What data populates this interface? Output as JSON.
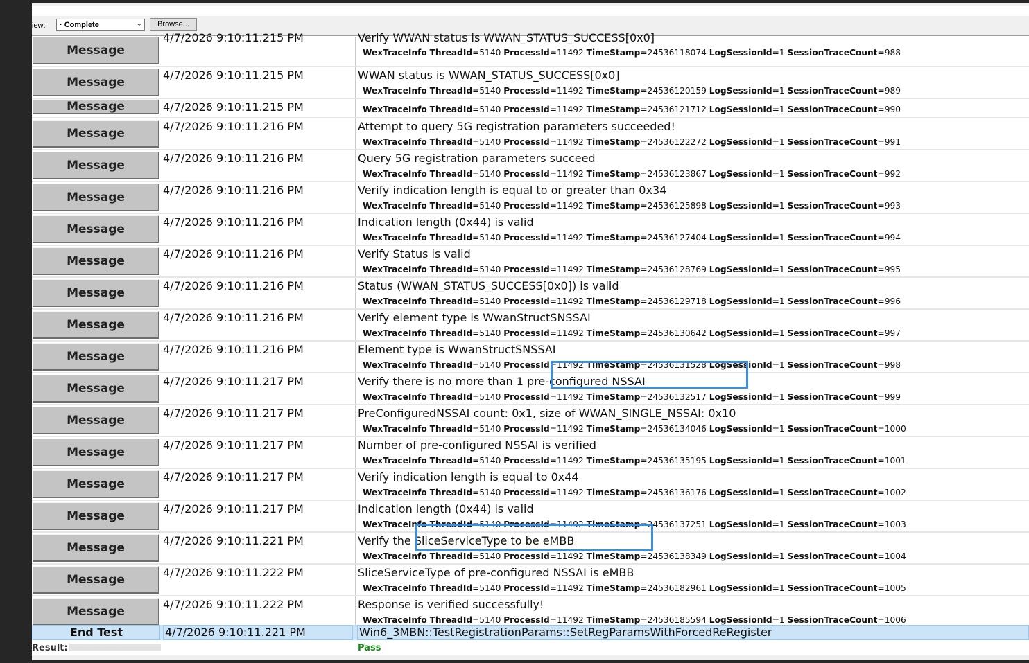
{
  "toolbar": {
    "view_label": "iew:",
    "view_value": "· Complete",
    "browse_label": "Browse..."
  },
  "top_partial": {
    "type": "Message",
    "timestamp": "4/7/2026 9:10:11.215 PM",
    "message": "Verify WWAN status is WWAN_STATUS_SUCCESS[0x0]",
    "trace": {
      "thread": "=5140 ",
      "process": "=11492 ",
      "timestamp": "=24536118074 ",
      "session": "=1 ",
      "count": "=988"
    }
  },
  "trace_keys": {
    "info": "WexTraceInfo",
    "thread": "ThreadId",
    "process": "ProcessId",
    "timestamp": "TimeStamp",
    "session": "LogSessionId",
    "count": "SessionTraceCount"
  },
  "rows": [
    {
      "type": "Message",
      "timestamp": "4/7/2026 9:10:11.215 PM",
      "message": "WWAN status is WWAN_STATUS_SUCCESS[0x0]",
      "trace": {
        "thread": "=5140 ",
        "process": "=11492 ",
        "timestamp": "=24536120159 ",
        "session": "=1 ",
        "count": "=989"
      }
    },
    {
      "type": "Message",
      "timestamp": "4/7/2026 9:10:11.215 PM",
      "message": "",
      "trace": {
        "thread": "=5140 ",
        "process": "=11492 ",
        "timestamp": "=24536121712 ",
        "session": "=1 ",
        "count": "=990"
      }
    },
    {
      "type": "Message",
      "timestamp": "4/7/2026 9:10:11.216 PM",
      "message": "Attempt to query 5G registration parameters succeeded!",
      "trace": {
        "thread": "=5140 ",
        "process": "=11492 ",
        "timestamp": "=24536122272 ",
        "session": "=1 ",
        "count": "=991"
      }
    },
    {
      "type": "Message",
      "timestamp": "4/7/2026 9:10:11.216 PM",
      "message": "Query 5G registration parameters succeed",
      "trace": {
        "thread": "=5140 ",
        "process": "=11492 ",
        "timestamp": "=24536123867 ",
        "session": "=1 ",
        "count": "=992"
      }
    },
    {
      "type": "Message",
      "timestamp": "4/7/2026 9:10:11.216 PM",
      "message": "Verify indication length is equal to or greater than 0x34",
      "trace": {
        "thread": "=5140 ",
        "process": "=11492 ",
        "timestamp": "=24536125898 ",
        "session": "=1 ",
        "count": "=993"
      }
    },
    {
      "type": "Message",
      "timestamp": "4/7/2026 9:10:11.216 PM",
      "message": "Indication length (0x44) is valid",
      "trace": {
        "thread": "=5140 ",
        "process": "=11492 ",
        "timestamp": "=24536127404 ",
        "session": "=1 ",
        "count": "=994"
      }
    },
    {
      "type": "Message",
      "timestamp": "4/7/2026 9:10:11.216 PM",
      "message": "Verify Status is valid",
      "trace": {
        "thread": "=5140 ",
        "process": "=11492 ",
        "timestamp": "=24536128769 ",
        "session": "=1 ",
        "count": "=995"
      }
    },
    {
      "type": "Message",
      "timestamp": "4/7/2026 9:10:11.216 PM",
      "message": "Status (WWAN_STATUS_SUCCESS[0x0]) is valid",
      "trace": {
        "thread": "=5140 ",
        "process": "=11492 ",
        "timestamp": "=24536129718 ",
        "session": "=1 ",
        "count": "=996"
      }
    },
    {
      "type": "Message",
      "timestamp": "4/7/2026 9:10:11.216 PM",
      "message": "Verify element type is WwanStructSNSSAI",
      "trace": {
        "thread": "=5140 ",
        "process": "=11492 ",
        "timestamp": "=24536130642 ",
        "session": "=1 ",
        "count": "=997"
      }
    },
    {
      "type": "Message",
      "timestamp": "4/7/2026 9:10:11.216 PM",
      "message": "Element type is WwanStructSNSSAI",
      "trace": {
        "thread": "=5140 ",
        "process": "=11492 ",
        "timestamp": "=24536131528 ",
        "session": "=1 ",
        "count": "=998"
      }
    },
    {
      "type": "Message",
      "timestamp": "4/7/2026 9:10:11.217 PM",
      "message": "Verify there is no more than 1 pre-configured NSSAI",
      "trace": {
        "thread": "=5140 ",
        "process": "=11492 ",
        "timestamp": "=24536132517 ",
        "session": "=1 ",
        "count": "=999"
      }
    },
    {
      "type": "Message",
      "timestamp": "4/7/2026 9:10:11.217 PM",
      "message": "PreConfiguredNSSAI count: 0x1, size of WWAN_SINGLE_NSSAI: 0x10",
      "trace": {
        "thread": "=5140 ",
        "process": "=11492 ",
        "timestamp": "=24536134046 ",
        "session": "=1 ",
        "count": "=1000"
      }
    },
    {
      "type": "Message",
      "timestamp": "4/7/2026 9:10:11.217 PM",
      "message": "Number of pre-configured NSSAI is verified",
      "trace": {
        "thread": "=5140 ",
        "process": "=11492 ",
        "timestamp": "=24536135195 ",
        "session": "=1 ",
        "count": "=1001"
      }
    },
    {
      "type": "Message",
      "timestamp": "4/7/2026 9:10:11.217 PM",
      "message": "Verify indication length is equal to 0x44",
      "trace": {
        "thread": "=5140 ",
        "process": "=11492 ",
        "timestamp": "=24536136176 ",
        "session": "=1 ",
        "count": "=1002"
      }
    },
    {
      "type": "Message",
      "timestamp": "4/7/2026 9:10:11.217 PM",
      "message": "Indication length (0x44) is valid",
      "trace": {
        "thread": "=5140 ",
        "process": "=11492 ",
        "timestamp": "=24536137251 ",
        "session": "=1 ",
        "count": "=1003"
      }
    },
    {
      "type": "Message",
      "timestamp": "4/7/2026 9:10:11.221 PM",
      "message": "Verify the SliceServiceType to be eMBB",
      "trace": {
        "thread": "=5140 ",
        "process": "=11492 ",
        "timestamp": "=24536138349 ",
        "session": "=1 ",
        "count": "=1004"
      }
    },
    {
      "type": "Message",
      "timestamp": "4/7/2026 9:10:11.222 PM",
      "message": "SliceServiceType of pre-configured NSSAI is eMBB",
      "trace": {
        "thread": "=5140 ",
        "process": "=11492 ",
        "timestamp": "=24536182961 ",
        "session": "=1 ",
        "count": "=1005"
      }
    },
    {
      "type": "Message",
      "timestamp": "4/7/2026 9:10:11.222 PM",
      "message": "Response is verified successfully!",
      "trace": {
        "thread": "=5140 ",
        "process": "=11492 ",
        "timestamp": "=24536185594 ",
        "session": "=1 ",
        "count": "=1006"
      }
    }
  ],
  "end_test": {
    "label": "End Test",
    "timestamp": "4/7/2026 9:10:11.221 PM",
    "message": "Win6_3MBN::TestRegistrationParams::SetRegParamsWithForcedReRegister"
  },
  "result": {
    "label": "Result:",
    "value": "Pass"
  },
  "colors": {
    "highlight": "#3b8fe0",
    "end_row": "#cce4f7",
    "pass": "#1a8a1a",
    "type_button": "#c4c4c4"
  }
}
